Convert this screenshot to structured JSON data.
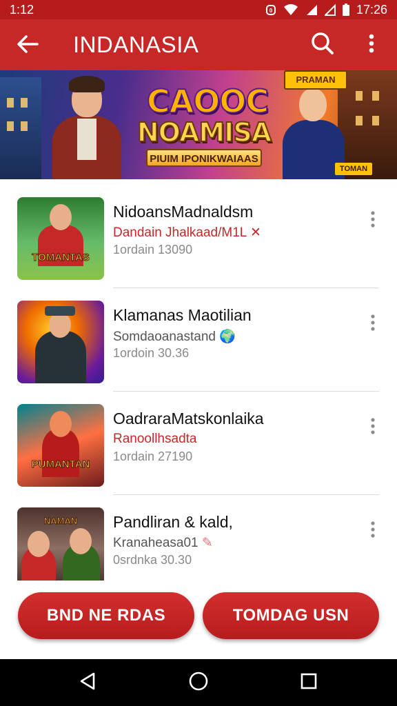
{
  "status_bar": {
    "time_left": "1:12",
    "time_right": "17:26",
    "icons": [
      "alarm-icon",
      "wifi-icon",
      "signal-icon",
      "no-sim-icon",
      "battery-icon"
    ]
  },
  "app_bar": {
    "title": "INDANASIA",
    "back_icon": "arrow-back-icon",
    "search_icon": "search-icon",
    "more_icon": "more-vert-icon"
  },
  "banner": {
    "badge": "PRAMAN",
    "title_line1": "CAOOC",
    "title_line2": "NOAMISA",
    "subtitle": "PIUIM IPONIKWAIAAS",
    "corner_label": "TOMAN"
  },
  "games": [
    {
      "title": "NidoansMadnaldsm",
      "subtitle": "Dandain Jhalkaad/M1L",
      "subtitle_mark": "✕",
      "subtitle_color": "#c62828",
      "meta": "1ordain 13090",
      "thumb_label": "TOMANTAS"
    },
    {
      "title": "Klamanas Maotilian",
      "subtitle": "Somdaoanastand",
      "subtitle_mark": "🌍",
      "subtitle_color": "#555555",
      "meta": "1ordoin 30.36",
      "thumb_label": ""
    },
    {
      "title": "OadraraMatskonlaika",
      "subtitle": "Ranoollhsadta",
      "subtitle_mark": "",
      "subtitle_color": "#c62828",
      "meta": "1ordain 27190",
      "thumb_label": "PUMANTAN"
    },
    {
      "title": "Pandliran & kald,",
      "subtitle": "Kranaheasa01",
      "subtitle_mark": "✎",
      "subtitle_color": "#555555",
      "meta": "0srdnka 30.30",
      "thumb_label": "NAMAN"
    }
  ],
  "actions": {
    "left_label": "BND NE RDAS",
    "right_label": "TOMDAG USN"
  },
  "colors": {
    "primary": "#c62828",
    "status_bar": "#b71c1c",
    "divider": "#dcdcdc",
    "meta_text": "#8a8a8a"
  }
}
